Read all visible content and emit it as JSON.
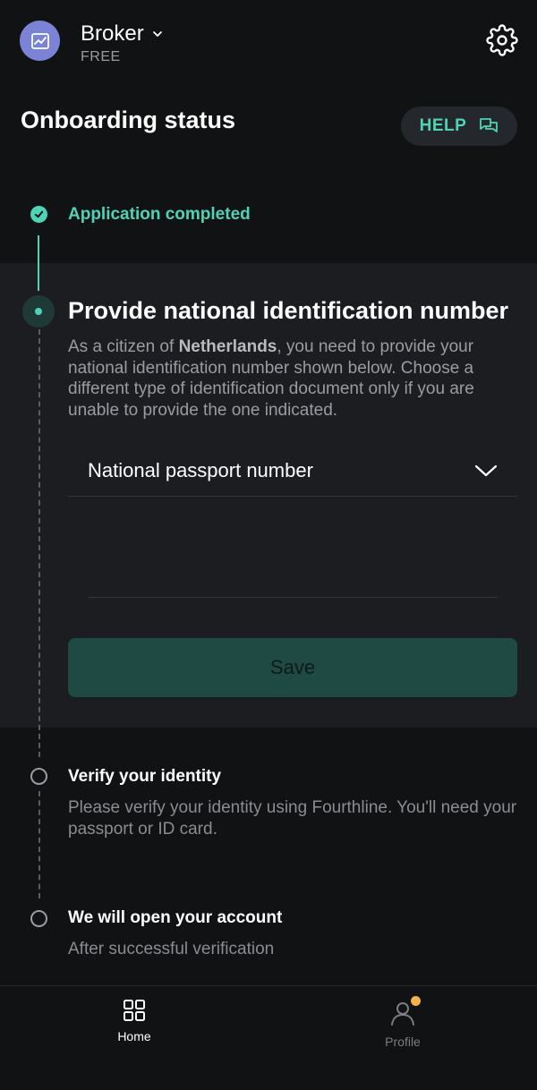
{
  "header": {
    "account_name": "Broker",
    "plan": "FREE",
    "avatar_icon": "chart-icon",
    "settings_icon": "gear-icon"
  },
  "title": "Onboarding status",
  "help_label": "HELP",
  "steps": [
    {
      "title": "Application completed",
      "status": "completed"
    },
    {
      "title": "Provide national identification number",
      "status": "active",
      "desc_prefix": "As a citizen of ",
      "desc_country": "Netherlands",
      "desc_suffix": ", you need to provide your national identification number shown below. Choose a different type of identification document only if you are unable to provide the one indicated."
    },
    {
      "title": "Verify your identity",
      "status": "pending",
      "desc": "Please verify your identity using Fourthline. You'll need your passport or ID card."
    },
    {
      "title": "We will open your account",
      "status": "pending",
      "desc": "After successful verification"
    }
  ],
  "form": {
    "document_type_selected": "National passport number",
    "id_value": "",
    "id_placeholder": "",
    "save_label": "Save"
  },
  "nav": {
    "home_label": "Home",
    "profile_label": "Profile"
  },
  "colors": {
    "accent": "#4fd3b6",
    "background": "#111214",
    "panel": "#1c1d21",
    "avatar": "#7b83d6",
    "badge": "#f5b14a"
  }
}
